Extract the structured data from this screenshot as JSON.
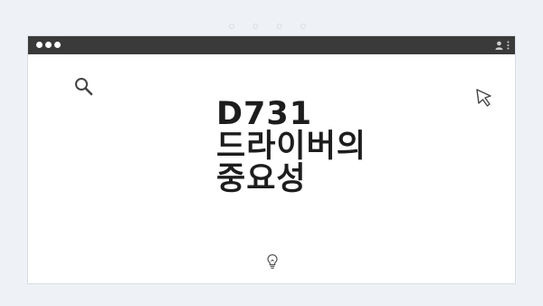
{
  "page": {
    "top_indicator": "○ ○ ○ ○"
  },
  "window": {
    "titlebar_color": "#3a3a3a",
    "traffic_lights": [
      "dot",
      "dot",
      "dot"
    ],
    "icons": {
      "top_right_user": "user-icon",
      "top_right_menu": "kebab-icon",
      "left_decor": "search-icon",
      "right_decor": "cursor-icon",
      "bottom_decor": "lightbulb-icon"
    }
  },
  "slide": {
    "title_line1": "D731",
    "title_line2": "드라이버의",
    "title_line3": "중요성"
  }
}
